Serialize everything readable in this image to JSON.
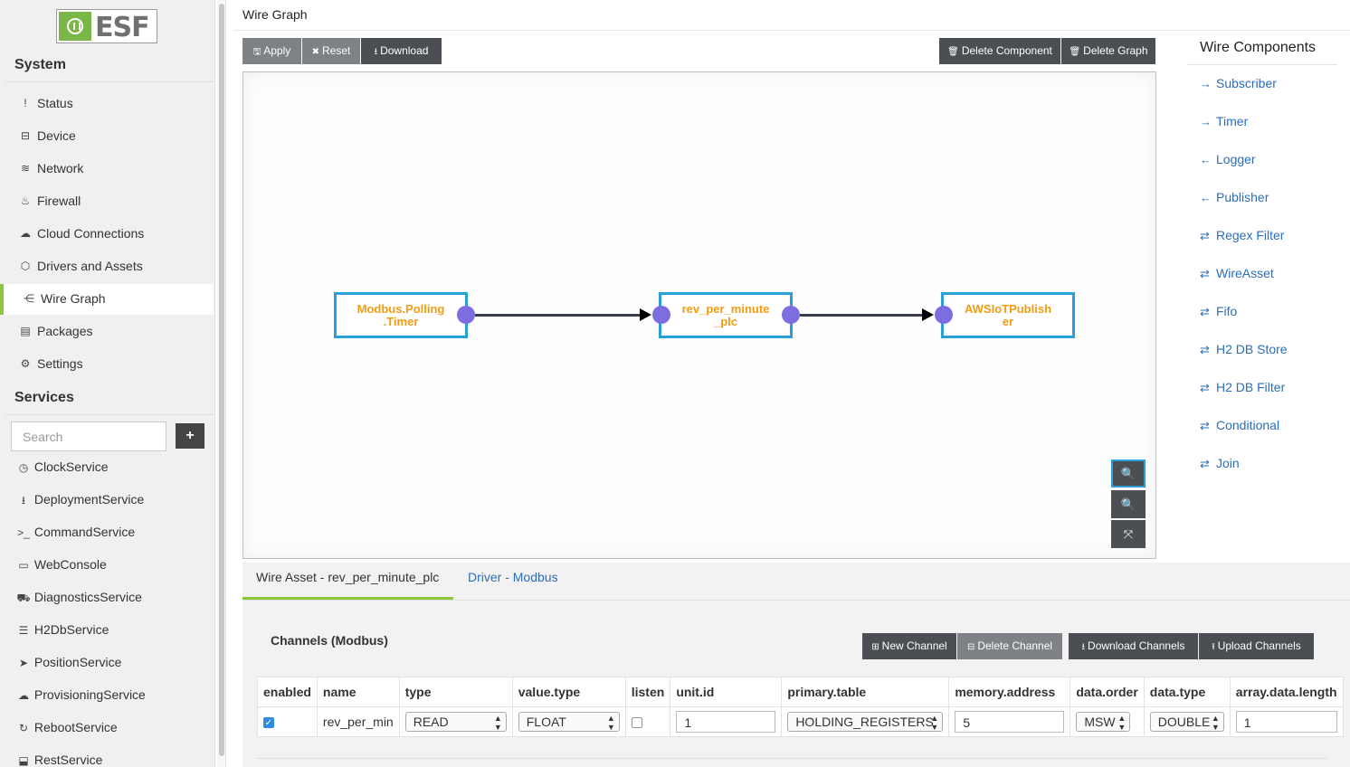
{
  "app": {
    "logo_text": "ESF"
  },
  "sidebar": {
    "system_heading": "System",
    "items": [
      {
        "label": "Status",
        "icon": "!"
      },
      {
        "label": "Device",
        "icon": "⊟"
      },
      {
        "label": "Network",
        "icon": "≋"
      },
      {
        "label": "Firewall",
        "icon": "♨"
      },
      {
        "label": "Cloud Connections",
        "icon": "☁"
      },
      {
        "label": "Drivers and Assets",
        "icon": "⬡"
      },
      {
        "label": "Wire Graph",
        "icon": "⋲"
      },
      {
        "label": "Packages",
        "icon": "▤"
      },
      {
        "label": "Settings",
        "icon": "⚙"
      }
    ],
    "services_heading": "Services",
    "search_placeholder": "Search",
    "add_label": "+",
    "services": [
      {
        "label": "ClockService",
        "icon": "◷"
      },
      {
        "label": "DeploymentService",
        "icon": "⭳"
      },
      {
        "label": "CommandService",
        "icon": ">_"
      },
      {
        "label": "WebConsole",
        "icon": "▭"
      },
      {
        "label": "DiagnosticsService",
        "icon": "⛟"
      },
      {
        "label": "H2DbService",
        "icon": "☰"
      },
      {
        "label": "PositionService",
        "icon": "➤"
      },
      {
        "label": "ProvisioningService",
        "icon": "☁"
      },
      {
        "label": "RebootService",
        "icon": "↻"
      },
      {
        "label": "RestService",
        "icon": "⬓"
      }
    ]
  },
  "page": {
    "title": "Wire Graph"
  },
  "toolbar": {
    "apply": "Apply",
    "reset": "Reset",
    "download": "Download",
    "delete_component": "Delete Component",
    "delete_graph": "Delete Graph"
  },
  "graph": {
    "nodes": [
      {
        "label": "Modbus.Polling.Timer",
        "line1": "Modbus.Polling",
        "line2": ".Timer"
      },
      {
        "label": "rev_per_minute_plc",
        "line1": "rev_per_minute",
        "line2": "_plc"
      },
      {
        "label": "AWSIoTPublisher",
        "line1": "AWSIoTPublish",
        "line2": "er"
      }
    ],
    "zoom_in_icon": "zoom-in-icon",
    "zoom_out_icon": "zoom-out-icon",
    "fit_icon": "fit-icon"
  },
  "palette": {
    "title": "Wire Components",
    "items": [
      {
        "label": "Subscriber",
        "icon": "→"
      },
      {
        "label": "Timer",
        "icon": "→"
      },
      {
        "label": "Logger",
        "icon": "←"
      },
      {
        "label": "Publisher",
        "icon": "←"
      },
      {
        "label": "Regex Filter",
        "icon": "⇄"
      },
      {
        "label": "WireAsset",
        "icon": "⇄"
      },
      {
        "label": "Fifo",
        "icon": "⇄"
      },
      {
        "label": "H2 DB Store",
        "icon": "⇄"
      },
      {
        "label": "H2 DB Filter",
        "icon": "⇄"
      },
      {
        "label": "Conditional",
        "icon": "⇄"
      },
      {
        "label": "Join",
        "icon": "⇄"
      }
    ]
  },
  "bottom": {
    "tabs": [
      "Wire Asset - rev_per_minute_plc",
      "Driver - Modbus"
    ],
    "channels_title": "Channels (Modbus)",
    "buttons": {
      "new_channel": "New Channel",
      "delete_channel": "Delete Channel",
      "download_channels": "Download Channels",
      "upload_channels": "Upload Channels"
    },
    "columns": [
      "enabled",
      "name",
      "type",
      "value.type",
      "listen",
      "unit.id",
      "primary.table",
      "memory.address",
      "data.order",
      "data.type",
      "array.data.length"
    ],
    "row": {
      "enabled": true,
      "name": "rev_per_min",
      "type": "READ",
      "value_type": "FLOAT",
      "listen": false,
      "unit_id": "1",
      "primary_table": "HOLDING_REGISTERS",
      "memory_address": "5",
      "data_order": "MSW",
      "data_type": "DOUBLE",
      "array_data_length": "1"
    }
  },
  "colors": {
    "accent": "#8cc63f",
    "node_border": "#2a9fd8",
    "node_text": "#f39c12",
    "port": "#7d6ee0",
    "link": "#2a6ebb"
  }
}
